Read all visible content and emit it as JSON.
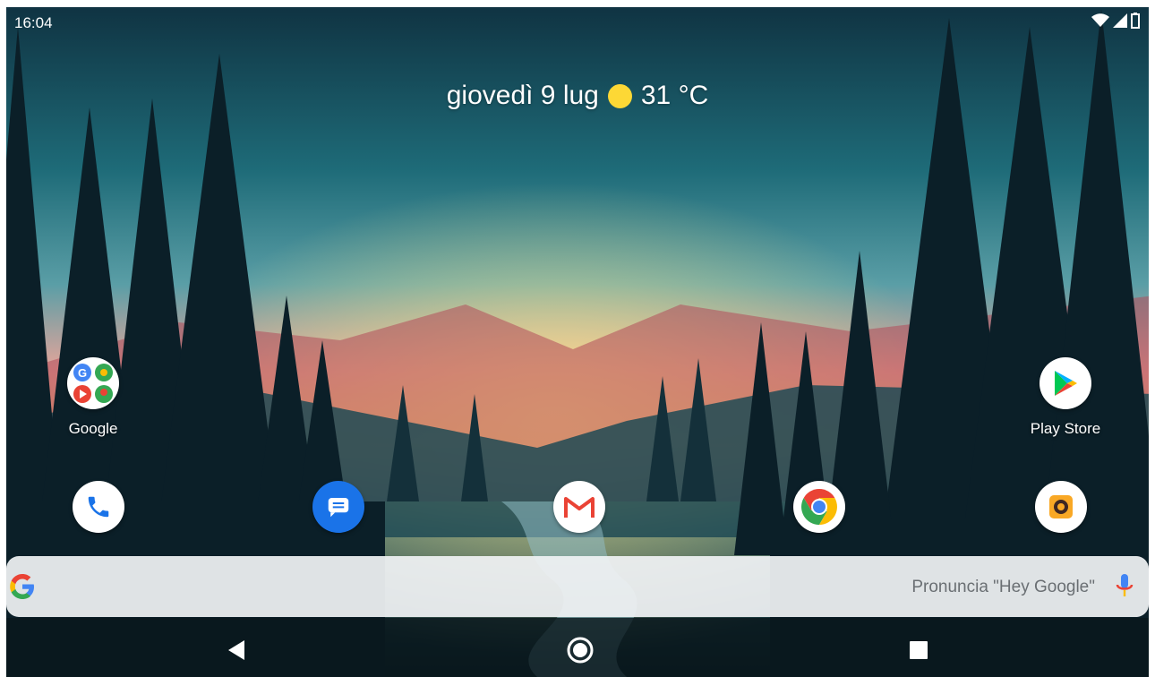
{
  "status_bar": {
    "time": "16:04",
    "icons": [
      "wifi-icon",
      "signal-icon",
      "battery-icon"
    ]
  },
  "glance": {
    "date": "giovedì 9 lug",
    "weather_icon": "sun-icon",
    "temperature": "31 °C"
  },
  "apps": {
    "google_folder": {
      "label": "Google",
      "icon": "google-folder-icon"
    },
    "play_store": {
      "label": "Play Store",
      "icon": "play-store-icon"
    },
    "dock": [
      {
        "name": "phone",
        "icon": "phone-icon"
      },
      {
        "name": "messages",
        "icon": "messages-icon"
      },
      {
        "name": "gmail",
        "icon": "gmail-icon"
      },
      {
        "name": "chrome",
        "icon": "chrome-icon"
      },
      {
        "name": "camera",
        "icon": "camera-icon"
      }
    ]
  },
  "search": {
    "placeholder": "Pronuncia \"Hey Google\"",
    "logo": "google-g-icon",
    "mic": "mic-icon"
  },
  "nav": {
    "buttons": [
      "back-icon",
      "home-icon",
      "recents-icon"
    ]
  },
  "colors": {
    "sun": "#fdd835",
    "phone": "#1a73e8",
    "messages": "#1a73e8",
    "gmail_red": "#ea4335",
    "camera": "#f9a825"
  }
}
